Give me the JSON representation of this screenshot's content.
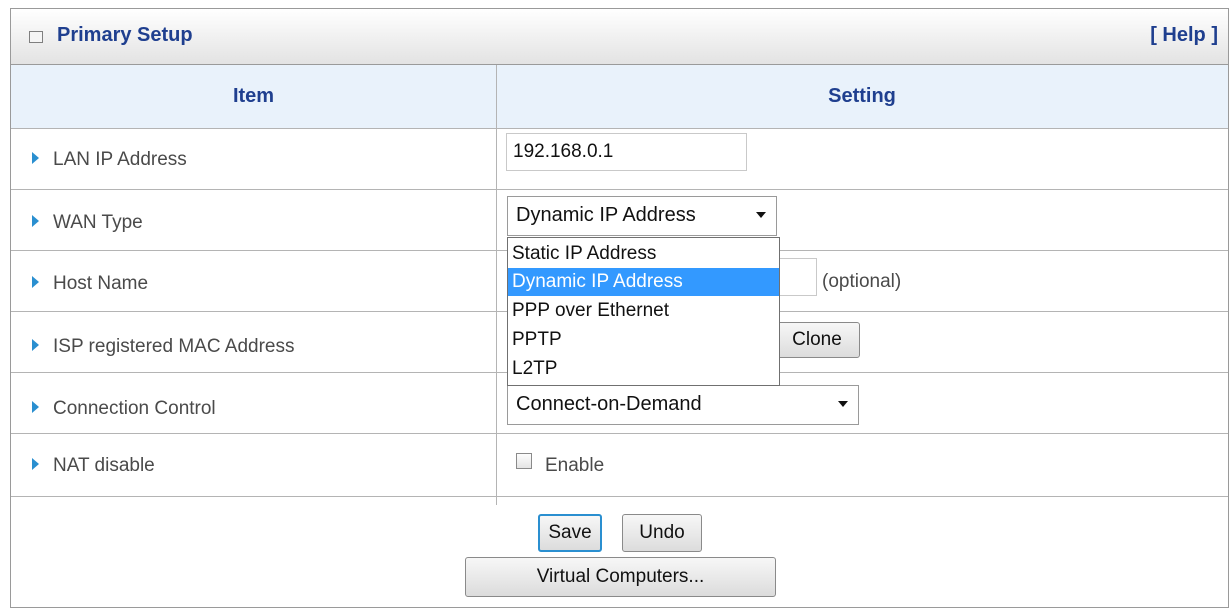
{
  "panel": {
    "title": "Primary Setup",
    "help": "[ Help ]"
  },
  "table": {
    "headers": {
      "item": "Item",
      "setting": "Setting"
    },
    "rows": [
      {
        "label": "LAN IP Address"
      },
      {
        "label": "WAN Type"
      },
      {
        "label": "Host Name"
      },
      {
        "label": "ISP registered MAC Address"
      },
      {
        "label": "Connection Control"
      },
      {
        "label": "NAT disable"
      }
    ]
  },
  "fields": {
    "lan_ip": "192.168.0.1",
    "wan_type_selected": "Dynamic IP Address",
    "host_name_hint": "(optional)",
    "clone_label": "Clone",
    "connection_control_selected": "Connect-on-Demand",
    "nat_enable_label": "Enable",
    "nat_enable_checked": false
  },
  "wan_dropdown": {
    "options": [
      "Static IP Address",
      "Dynamic IP Address",
      "PPP over Ethernet",
      "PPTP",
      "L2TP"
    ],
    "highlighted_index": 1
  },
  "actions": {
    "save": "Save",
    "undo": "Undo",
    "virtual_computers": "Virtual Computers..."
  },
  "colors": {
    "title_text": "#1f3f8f",
    "header_bg": "#e9f2fb",
    "highlight": "#3399ff",
    "arrow": "#2a8fd0"
  }
}
